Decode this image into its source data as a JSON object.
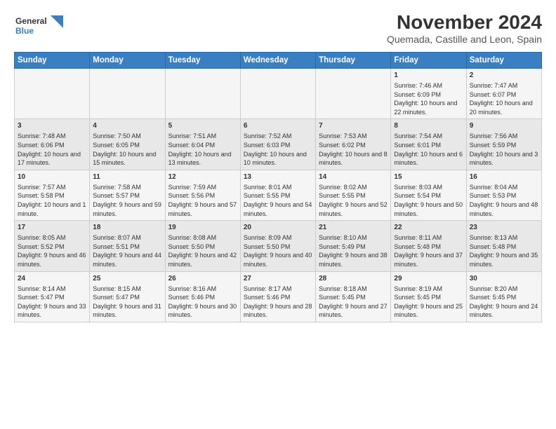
{
  "logo": {
    "line1": "General",
    "line2": "Blue"
  },
  "title": "November 2024",
  "subtitle": "Quemada, Castille and Leon, Spain",
  "weekdays": [
    "Sunday",
    "Monday",
    "Tuesday",
    "Wednesday",
    "Thursday",
    "Friday",
    "Saturday"
  ],
  "weeks": [
    [
      {
        "day": "",
        "text": ""
      },
      {
        "day": "",
        "text": ""
      },
      {
        "day": "",
        "text": ""
      },
      {
        "day": "",
        "text": ""
      },
      {
        "day": "",
        "text": ""
      },
      {
        "day": "1",
        "text": "Sunrise: 7:46 AM\nSunset: 6:09 PM\nDaylight: 10 hours and 22 minutes."
      },
      {
        "day": "2",
        "text": "Sunrise: 7:47 AM\nSunset: 6:07 PM\nDaylight: 10 hours and 20 minutes."
      }
    ],
    [
      {
        "day": "3",
        "text": "Sunrise: 7:48 AM\nSunset: 6:06 PM\nDaylight: 10 hours and 17 minutes."
      },
      {
        "day": "4",
        "text": "Sunrise: 7:50 AM\nSunset: 6:05 PM\nDaylight: 10 hours and 15 minutes."
      },
      {
        "day": "5",
        "text": "Sunrise: 7:51 AM\nSunset: 6:04 PM\nDaylight: 10 hours and 13 minutes."
      },
      {
        "day": "6",
        "text": "Sunrise: 7:52 AM\nSunset: 6:03 PM\nDaylight: 10 hours and 10 minutes."
      },
      {
        "day": "7",
        "text": "Sunrise: 7:53 AM\nSunset: 6:02 PM\nDaylight: 10 hours and 8 minutes."
      },
      {
        "day": "8",
        "text": "Sunrise: 7:54 AM\nSunset: 6:01 PM\nDaylight: 10 hours and 6 minutes."
      },
      {
        "day": "9",
        "text": "Sunrise: 7:56 AM\nSunset: 5:59 PM\nDaylight: 10 hours and 3 minutes."
      }
    ],
    [
      {
        "day": "10",
        "text": "Sunrise: 7:57 AM\nSunset: 5:58 PM\nDaylight: 10 hours and 1 minute."
      },
      {
        "day": "11",
        "text": "Sunrise: 7:58 AM\nSunset: 5:57 PM\nDaylight: 9 hours and 59 minutes."
      },
      {
        "day": "12",
        "text": "Sunrise: 7:59 AM\nSunset: 5:56 PM\nDaylight: 9 hours and 57 minutes."
      },
      {
        "day": "13",
        "text": "Sunrise: 8:01 AM\nSunset: 5:55 PM\nDaylight: 9 hours and 54 minutes."
      },
      {
        "day": "14",
        "text": "Sunrise: 8:02 AM\nSunset: 5:55 PM\nDaylight: 9 hours and 52 minutes."
      },
      {
        "day": "15",
        "text": "Sunrise: 8:03 AM\nSunset: 5:54 PM\nDaylight: 9 hours and 50 minutes."
      },
      {
        "day": "16",
        "text": "Sunrise: 8:04 AM\nSunset: 5:53 PM\nDaylight: 9 hours and 48 minutes."
      }
    ],
    [
      {
        "day": "17",
        "text": "Sunrise: 8:05 AM\nSunset: 5:52 PM\nDaylight: 9 hours and 46 minutes."
      },
      {
        "day": "18",
        "text": "Sunrise: 8:07 AM\nSunset: 5:51 PM\nDaylight: 9 hours and 44 minutes."
      },
      {
        "day": "19",
        "text": "Sunrise: 8:08 AM\nSunset: 5:50 PM\nDaylight: 9 hours and 42 minutes."
      },
      {
        "day": "20",
        "text": "Sunrise: 8:09 AM\nSunset: 5:50 PM\nDaylight: 9 hours and 40 minutes."
      },
      {
        "day": "21",
        "text": "Sunrise: 8:10 AM\nSunset: 5:49 PM\nDaylight: 9 hours and 38 minutes."
      },
      {
        "day": "22",
        "text": "Sunrise: 8:11 AM\nSunset: 5:48 PM\nDaylight: 9 hours and 37 minutes."
      },
      {
        "day": "23",
        "text": "Sunrise: 8:13 AM\nSunset: 5:48 PM\nDaylight: 9 hours and 35 minutes."
      }
    ],
    [
      {
        "day": "24",
        "text": "Sunrise: 8:14 AM\nSunset: 5:47 PM\nDaylight: 9 hours and 33 minutes."
      },
      {
        "day": "25",
        "text": "Sunrise: 8:15 AM\nSunset: 5:47 PM\nDaylight: 9 hours and 31 minutes."
      },
      {
        "day": "26",
        "text": "Sunrise: 8:16 AM\nSunset: 5:46 PM\nDaylight: 9 hours and 30 minutes."
      },
      {
        "day": "27",
        "text": "Sunrise: 8:17 AM\nSunset: 5:46 PM\nDaylight: 9 hours and 28 minutes."
      },
      {
        "day": "28",
        "text": "Sunrise: 8:18 AM\nSunset: 5:45 PM\nDaylight: 9 hours and 27 minutes."
      },
      {
        "day": "29",
        "text": "Sunrise: 8:19 AM\nSunset: 5:45 PM\nDaylight: 9 hours and 25 minutes."
      },
      {
        "day": "30",
        "text": "Sunrise: 8:20 AM\nSunset: 5:45 PM\nDaylight: 9 hours and 24 minutes."
      }
    ]
  ]
}
